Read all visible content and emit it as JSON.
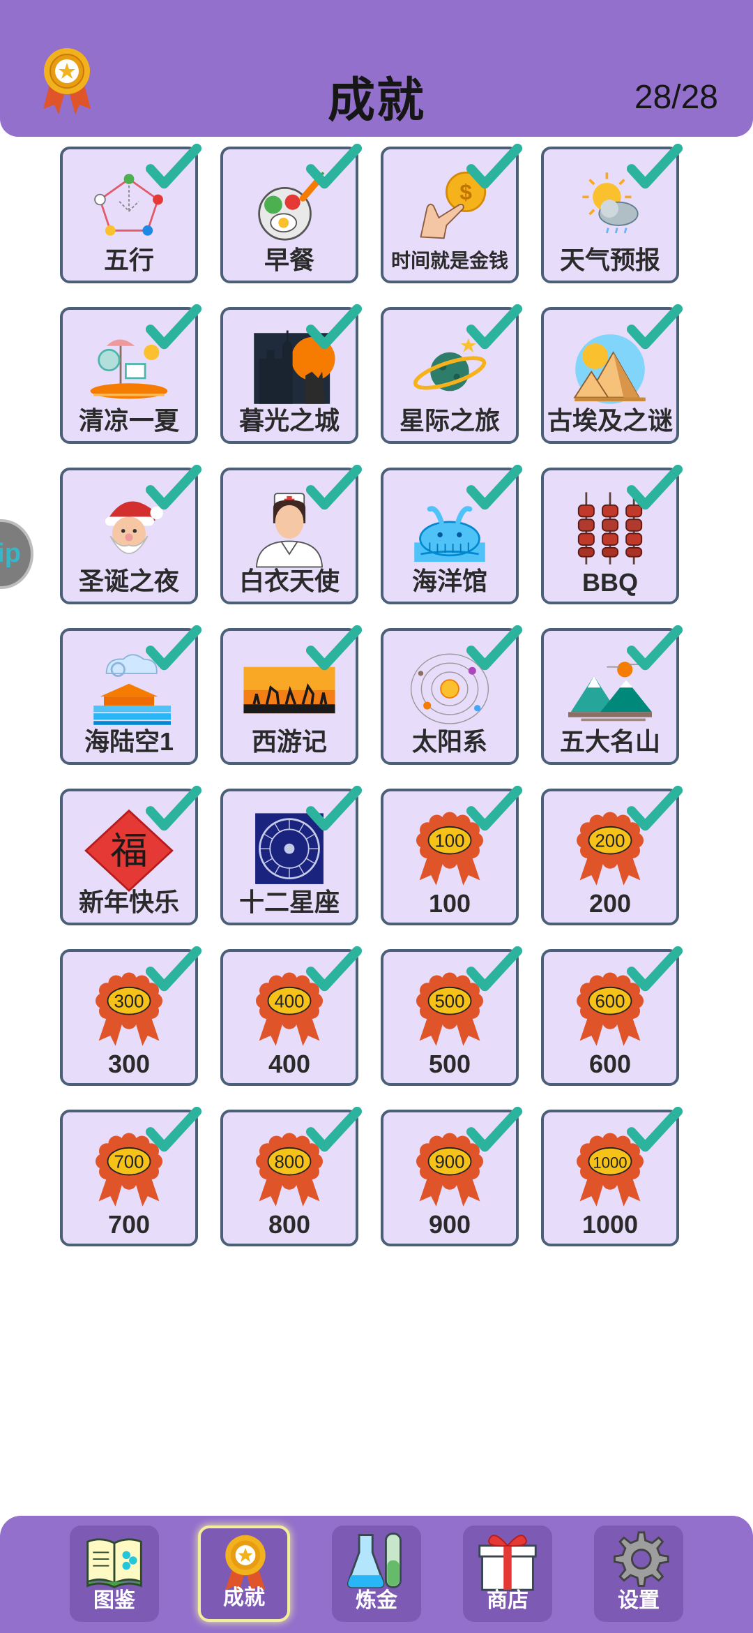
{
  "header": {
    "title": "成就",
    "count": "28/28"
  },
  "side_tab": {
    "text": "ip"
  },
  "achievements": [
    {
      "label": "五行",
      "icon": "pentagon-icon"
    },
    {
      "label": "早餐",
      "icon": "breakfast-icon"
    },
    {
      "label": "时间就是金钱",
      "icon": "coin-hand-icon"
    },
    {
      "label": "天气预报",
      "icon": "weather-icon"
    },
    {
      "label": "清凉一夏",
      "icon": "beach-icon"
    },
    {
      "label": "暮光之城",
      "icon": "castle-icon"
    },
    {
      "label": "星际之旅",
      "icon": "planet-icon"
    },
    {
      "label": "古埃及之谜",
      "icon": "pyramid-icon"
    },
    {
      "label": "圣诞之夜",
      "icon": "santa-icon"
    },
    {
      "label": "白衣天使",
      "icon": "nurse-icon"
    },
    {
      "label": "海洋馆",
      "icon": "whale-icon"
    },
    {
      "label": "BBQ",
      "icon": "skewer-icon"
    },
    {
      "label": "海陆空1",
      "icon": "sea-land-air-icon"
    },
    {
      "label": "西游记",
      "icon": "journey-west-icon"
    },
    {
      "label": "太阳系",
      "icon": "solar-system-icon"
    },
    {
      "label": "五大名山",
      "icon": "mountains-icon"
    },
    {
      "label": "新年快乐",
      "icon": "fu-icon",
      "fu": "福"
    },
    {
      "label": "十二星座",
      "icon": "zodiac-icon"
    },
    {
      "label": "100",
      "icon": "ribbon-icon",
      "badge": "100"
    },
    {
      "label": "200",
      "icon": "ribbon-icon",
      "badge": "200"
    },
    {
      "label": "300",
      "icon": "ribbon-icon",
      "badge": "300"
    },
    {
      "label": "400",
      "icon": "ribbon-icon",
      "badge": "400"
    },
    {
      "label": "500",
      "icon": "ribbon-icon",
      "badge": "500"
    },
    {
      "label": "600",
      "icon": "ribbon-icon",
      "badge": "600"
    },
    {
      "label": "700",
      "icon": "ribbon-icon",
      "badge": "700"
    },
    {
      "label": "800",
      "icon": "ribbon-icon",
      "badge": "800"
    },
    {
      "label": "900",
      "icon": "ribbon-icon",
      "badge": "900"
    },
    {
      "label": "1000",
      "icon": "ribbon-icon",
      "badge": "1000"
    }
  ],
  "nav": [
    {
      "label": "图鉴",
      "icon": "book-icon",
      "active": false
    },
    {
      "label": "成就",
      "icon": "medal-icon",
      "active": true
    },
    {
      "label": "炼金",
      "icon": "flask-icon",
      "active": false
    },
    {
      "label": "商店",
      "icon": "gift-icon",
      "active": false
    },
    {
      "label": "设置",
      "icon": "gear-icon",
      "active": false
    }
  ],
  "colors": {
    "header": "#9270cc",
    "card": "#e7dcfa",
    "border": "#4c5f78",
    "check": "#2bb39e"
  }
}
